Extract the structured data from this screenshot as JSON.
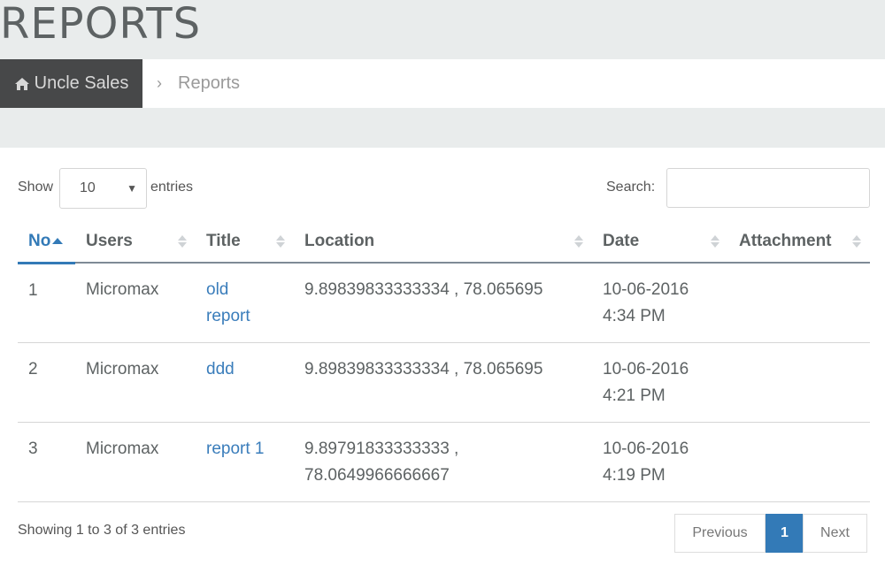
{
  "header": {
    "title": "REPORTS"
  },
  "breadcrumb": {
    "home_label": "Uncle Sales",
    "separator": "›",
    "current": "Reports"
  },
  "controls": {
    "show_label": "Show",
    "length_value": "10",
    "entries_label": "entries",
    "search_label": "Search:",
    "search_value": ""
  },
  "table": {
    "columns": [
      "No",
      "Users",
      "Title",
      "Location",
      "Date",
      "Attachment"
    ],
    "rows": [
      {
        "no": "1",
        "user": "Micromax",
        "title_l1": "old",
        "title_l2": "report",
        "loc_l1": "9.89839833333334 , 78.065695",
        "loc_l2": "",
        "date_l1": "10-06-2016",
        "date_l2": "4:34 PM",
        "attachment": ""
      },
      {
        "no": "2",
        "user": "Micromax",
        "title_l1": "ddd",
        "title_l2": "",
        "loc_l1": "9.89839833333334 , 78.065695",
        "loc_l2": "",
        "date_l1": "10-06-2016",
        "date_l2": "4:21 PM",
        "attachment": ""
      },
      {
        "no": "3",
        "user": "Micromax",
        "title_l1": "report 1",
        "title_l2": "",
        "loc_l1": "9.89791833333333 ,",
        "loc_l2": "78.0649966666667",
        "date_l1": "10-06-2016",
        "date_l2": "4:19 PM",
        "attachment": ""
      }
    ]
  },
  "footer": {
    "info": "Showing 1 to 3 of 3 entries",
    "prev_label": "Previous",
    "current_page": "1",
    "next_label": "Next"
  },
  "colors": {
    "accent": "#337ab7",
    "header_bg": "#e9ecec",
    "home_bg": "#474849"
  },
  "icons": {
    "home": "home-icon",
    "sort": "sort-icon",
    "sort_asc": "sort-asc-icon",
    "select_caret": "caret-down-icon"
  }
}
